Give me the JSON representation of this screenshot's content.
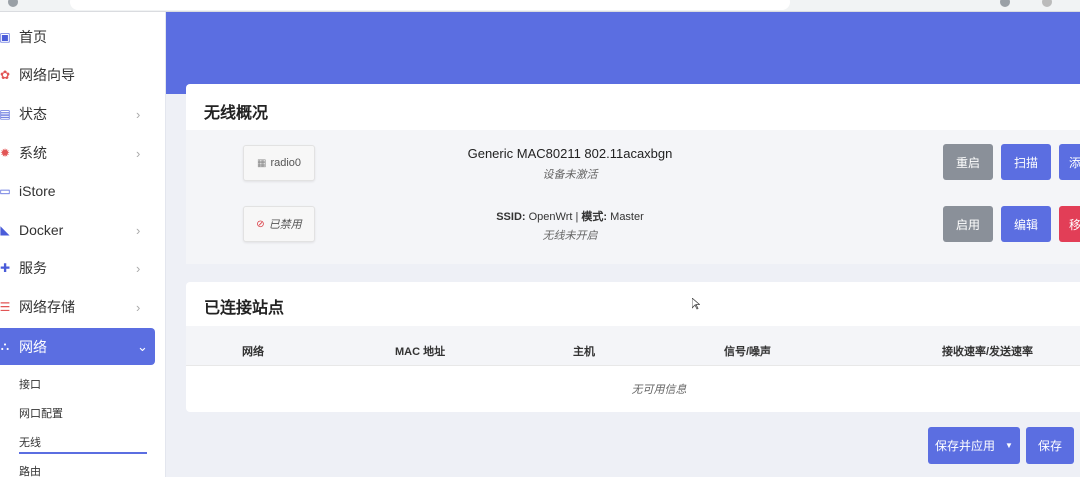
{
  "sidebar": {
    "items": [
      {
        "label": "首页",
        "icon": "home-icon",
        "chevron": ""
      },
      {
        "label": "网络向导",
        "icon": "wizard-icon",
        "chevron": ""
      },
      {
        "label": "状态",
        "icon": "status-icon",
        "chevron": "›"
      },
      {
        "label": "系统",
        "icon": "system-gear-icon",
        "chevron": "›"
      },
      {
        "label": "iStore",
        "icon": "store-icon",
        "chevron": ""
      },
      {
        "label": "Docker",
        "icon": "docker-icon",
        "chevron": "›"
      },
      {
        "label": "服务",
        "icon": "services-icon",
        "chevron": "›"
      },
      {
        "label": "网络存储",
        "icon": "storage-icon",
        "chevron": "›"
      },
      {
        "label": "网络",
        "icon": "network-icon",
        "chevron": "⌄"
      }
    ],
    "subitems": [
      "接口",
      "网口配置",
      "无线",
      "路由"
    ]
  },
  "wireless": {
    "title": "无线概况",
    "radio": {
      "badge": "radio0",
      "name": "Generic MAC80211 802.11acaxbgn",
      "status": "设备未激活",
      "buttons": [
        "重启",
        "扫描",
        "添"
      ]
    },
    "network": {
      "badge": "已禁用",
      "ssid_label": "SSID:",
      "ssid_value": "OpenWrt",
      "separator": "|",
      "mode_label": "模式:",
      "mode_value": "Master",
      "status": "无线未开启",
      "buttons": [
        "启用",
        "编辑",
        "移"
      ]
    }
  },
  "stations": {
    "title": "已连接站点",
    "columns": [
      "网络",
      "MAC 地址",
      "主机",
      "信号/噪声",
      "接收速率/发送速率"
    ],
    "empty": "无可用信息"
  },
  "actions": {
    "save_apply": "保存并应用",
    "save_apply_caret": "▼",
    "save": "保存"
  },
  "colors": {
    "accent": "#5b6ee1",
    "danger": "#e23e57",
    "neutral": "#8a9099"
  }
}
